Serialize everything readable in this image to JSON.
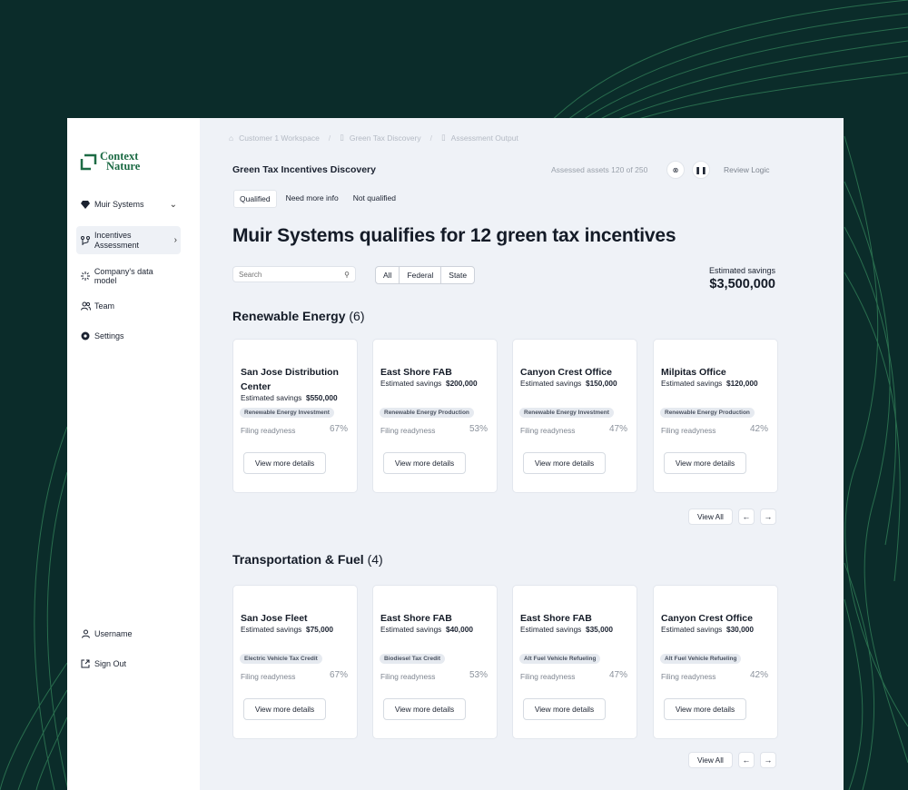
{
  "brand": {
    "line1": "Context",
    "line2": "Nature",
    "accent": "#1d6b45",
    "background": "#0b2c2a"
  },
  "sidebar": {
    "items": [
      {
        "label": "Muir Systems",
        "icon": "gem-icon"
      },
      {
        "label": "Incentives Assessment",
        "icon": "branch-icon"
      },
      {
        "label": "Company's data model",
        "icon": "spark-icon"
      },
      {
        "label": "Team",
        "icon": "team-icon"
      },
      {
        "label": "Settings",
        "icon": "gear-icon"
      }
    ],
    "footer": [
      {
        "label": "Username",
        "icon": "user-icon"
      },
      {
        "label": "Sign Out",
        "icon": "signout-icon"
      }
    ]
  },
  "breadcrumb": [
    "Customer 1 Workspace",
    "Green Tax Discovery",
    "Assessment Output"
  ],
  "header": {
    "title": "Green Tax Incentives Discovery",
    "assessed": "Assessed assets 120 of 250",
    "review": "Review Logic"
  },
  "tabs": [
    "Qualified",
    "Need more info",
    "Not qualified"
  ],
  "headline": "Muir Systems qualifies for 12 green tax incentives",
  "search": {
    "placeholder": "Search"
  },
  "filters": [
    "All",
    "Federal",
    "State"
  ],
  "savings": {
    "label": "Estimated savings",
    "value": "$3,500,000"
  },
  "sections": [
    {
      "title": "Renewable Energy",
      "count": "(6)",
      "cards": [
        {
          "name": "San Jose Distribution Center",
          "saving_label": "Estimated savings",
          "saving": "$550,000",
          "tag": "Renewable Energy Investment",
          "filing": "Filing readyness",
          "pct": "67%",
          "button": "View more details"
        },
        {
          "name": "East Shore FAB",
          "saving_label": "Estimated savings",
          "saving": "$200,000",
          "tag": "Renewable Energy Production",
          "filing": "Filing readyness",
          "pct": "53%",
          "button": "View more details"
        },
        {
          "name": "Canyon Crest Office",
          "saving_label": "Estimated savings",
          "saving": "$150,000",
          "tag": "Renewable Energy Investment",
          "filing": "Filing readyness",
          "pct": "47%",
          "button": "View more details"
        },
        {
          "name": "Milpitas Office",
          "saving_label": "Estimated savings",
          "saving": "$120,000",
          "tag": "Renewable Energy Production",
          "filing": "Filing readyness",
          "pct": "42%",
          "button": "View more details"
        }
      ],
      "view_all": "View All"
    },
    {
      "title": "Transportation & Fuel",
      "count": "(4)",
      "cards": [
        {
          "name": "San Jose Fleet",
          "saving_label": "Estimated savings",
          "saving": "$75,000",
          "tag": "Electric Vehicle Tax Credit",
          "filing": "Filing readyness",
          "pct": "67%",
          "button": "View more details"
        },
        {
          "name": "East Shore FAB",
          "saving_label": "Estimated savings",
          "saving": "$40,000",
          "tag": "Biodiesel Tax Credit",
          "filing": "Filing readyness",
          "pct": "53%",
          "button": "View more details"
        },
        {
          "name": "East Shore FAB",
          "saving_label": "Estimated savings",
          "saving": "$35,000",
          "tag": "Alt Fuel Vehicle Refueling",
          "filing": "Filing readyness",
          "pct": "47%",
          "button": "View more details"
        },
        {
          "name": "Canyon Crest Office",
          "saving_label": "Estimated savings",
          "saving": "$30,000",
          "tag": "Alt Fuel Vehicle Refueling",
          "filing": "Filing readyness",
          "pct": "42%",
          "button": "View more details"
        }
      ],
      "view_all": "View All"
    }
  ]
}
